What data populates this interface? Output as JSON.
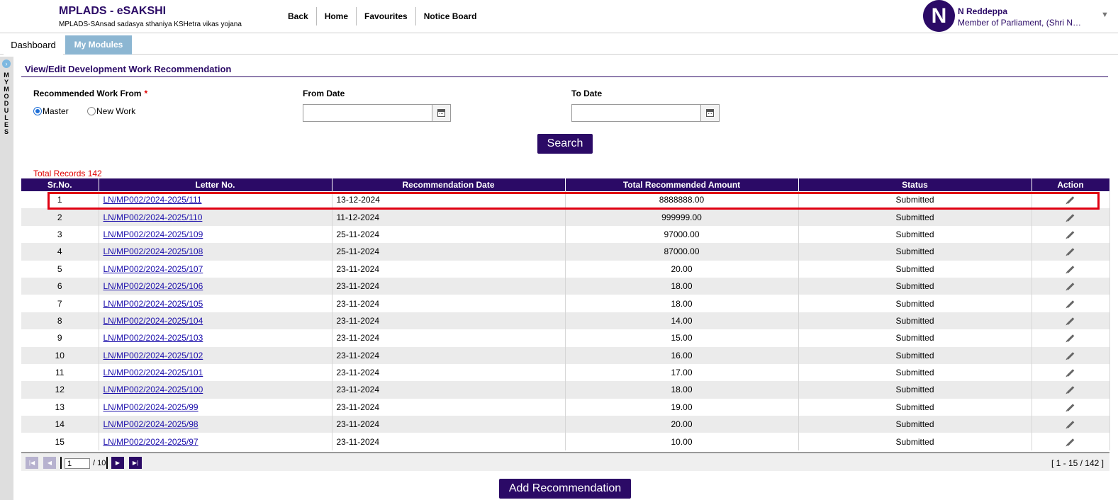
{
  "app": {
    "title": "MPLADS - eSAKSHI",
    "subtitle": "MPLADS-SAnsad sadasya sthaniya KSHetra vikas yojana"
  },
  "topnav": [
    "Back",
    "Home",
    "Favourites",
    "Notice Board"
  ],
  "user": {
    "initial": "N",
    "name": "N Reddeppa",
    "role": "Member of Parliament, (Shri N…"
  },
  "tabs": {
    "dashboard": "Dashboard",
    "modules": "My Modules"
  },
  "sidebar": {
    "label": "MY MODULES"
  },
  "page": {
    "title": "View/Edit Development Work Recommendation"
  },
  "filters": {
    "work_from_label": "Recommended Work From",
    "required_mark": "*",
    "option_master": "Master",
    "option_new": "New Work",
    "selected": "Master",
    "from_date_label": "From Date",
    "from_date_value": "",
    "to_date_label": "To Date",
    "to_date_value": "",
    "search_label": "Search"
  },
  "total_records": "Total Records 142",
  "table": {
    "columns": [
      "Sr.No.",
      "Letter No.",
      "Recommendation Date",
      "Total Recommended Amount",
      "Status",
      "Action"
    ],
    "rows": [
      {
        "sr": "1",
        "letter": "LN/MP002/2024-2025/111",
        "date": "13-12-2024",
        "amount": "8888888.00",
        "status": "Submitted"
      },
      {
        "sr": "2",
        "letter": "LN/MP002/2024-2025/110",
        "date": "11-12-2024",
        "amount": "999999.00",
        "status": "Submitted"
      },
      {
        "sr": "3",
        "letter": "LN/MP002/2024-2025/109",
        "date": "25-11-2024",
        "amount": "97000.00",
        "status": "Submitted"
      },
      {
        "sr": "4",
        "letter": "LN/MP002/2024-2025/108",
        "date": "25-11-2024",
        "amount": "87000.00",
        "status": "Submitted"
      },
      {
        "sr": "5",
        "letter": "LN/MP002/2024-2025/107",
        "date": "23-11-2024",
        "amount": "20.00",
        "status": "Submitted"
      },
      {
        "sr": "6",
        "letter": "LN/MP002/2024-2025/106",
        "date": "23-11-2024",
        "amount": "18.00",
        "status": "Submitted"
      },
      {
        "sr": "7",
        "letter": "LN/MP002/2024-2025/105",
        "date": "23-11-2024",
        "amount": "18.00",
        "status": "Submitted"
      },
      {
        "sr": "8",
        "letter": "LN/MP002/2024-2025/104",
        "date": "23-11-2024",
        "amount": "14.00",
        "status": "Submitted"
      },
      {
        "sr": "9",
        "letter": "LN/MP002/2024-2025/103",
        "date": "23-11-2024",
        "amount": "15.00",
        "status": "Submitted"
      },
      {
        "sr": "10",
        "letter": "LN/MP002/2024-2025/102",
        "date": "23-11-2024",
        "amount": "16.00",
        "status": "Submitted"
      },
      {
        "sr": "11",
        "letter": "LN/MP002/2024-2025/101",
        "date": "23-11-2024",
        "amount": "17.00",
        "status": "Submitted"
      },
      {
        "sr": "12",
        "letter": "LN/MP002/2024-2025/100",
        "date": "23-11-2024",
        "amount": "18.00",
        "status": "Submitted"
      },
      {
        "sr": "13",
        "letter": "LN/MP002/2024-2025/99",
        "date": "23-11-2024",
        "amount": "19.00",
        "status": "Submitted"
      },
      {
        "sr": "14",
        "letter": "LN/MP002/2024-2025/98",
        "date": "23-11-2024",
        "amount": "20.00",
        "status": "Submitted"
      },
      {
        "sr": "15",
        "letter": "LN/MP002/2024-2025/97",
        "date": "23-11-2024",
        "amount": "10.00",
        "status": "Submitted"
      }
    ]
  },
  "pager": {
    "page_input": "1",
    "total_pages": "/ 10",
    "range": "[ 1 - 15 / 142 ]"
  },
  "add_button_label": "Add Recommendation",
  "colors": {
    "brand": "#2b0a66",
    "tab_active": "#8cb6d2",
    "highlight_border": "#e00012",
    "link": "#1a0dab"
  }
}
